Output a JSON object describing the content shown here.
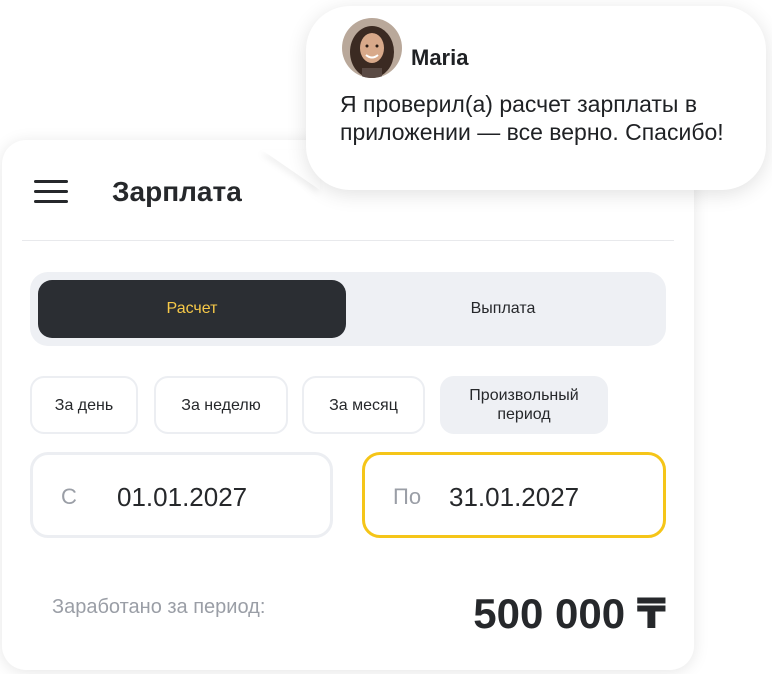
{
  "header": {
    "title": "Зарплата"
  },
  "tabs": [
    {
      "label": "Расчет",
      "active": true
    },
    {
      "label": "Выплата",
      "active": false
    }
  ],
  "periods": [
    {
      "label": "За день"
    },
    {
      "label": "За неделю"
    },
    {
      "label": "За месяц"
    },
    {
      "label": "Произвольный период",
      "selected": true
    }
  ],
  "date_range": {
    "from": {
      "prefix": "С",
      "value": "01.01.2027"
    },
    "to": {
      "prefix": "По",
      "value": "31.01.2027"
    }
  },
  "summary": {
    "label": "Заработано за период:",
    "amount": "500 000 ₸"
  },
  "chat": {
    "sender": "Maria",
    "message": "Я проверил(а) расчет зарплаты в приложении — все верно. Спасибо!",
    "avatar_icon": "user-avatar"
  },
  "colors": {
    "accent": "#f5c518",
    "active_tab_bg": "#2b2e33",
    "active_tab_text": "#f7c948",
    "muted_text": "#9a9ea6"
  }
}
